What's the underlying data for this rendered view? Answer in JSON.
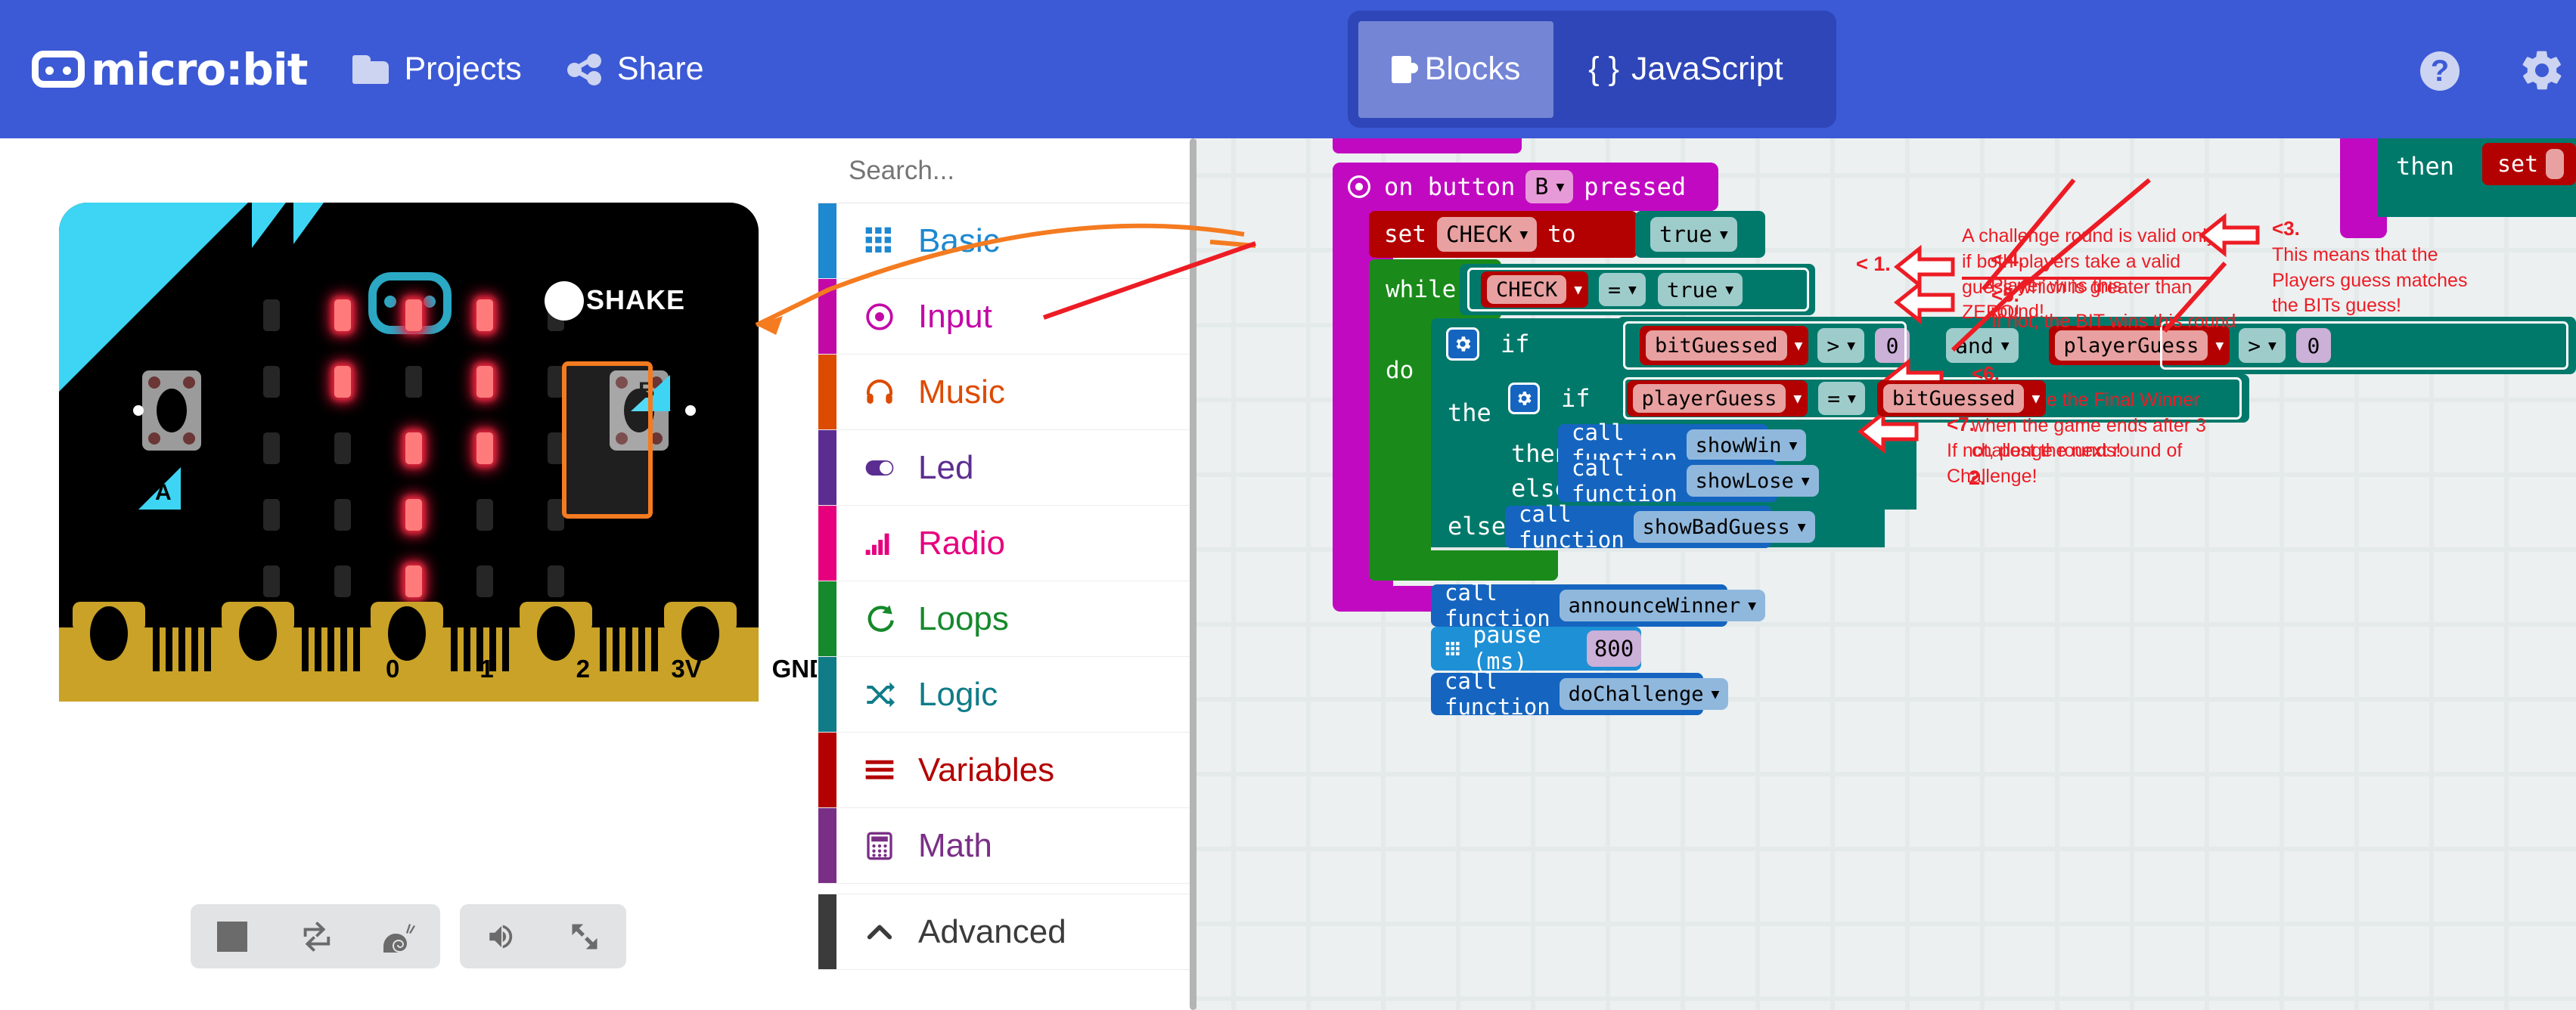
{
  "header": {
    "brand": "micro:bit",
    "projects_label": "Projects",
    "share_label": "Share",
    "tabs": [
      {
        "id": "blocks",
        "label": "Blocks",
        "active": true
      },
      {
        "id": "javascript",
        "label": "JavaScript",
        "active": false
      }
    ],
    "help_glyph": "?",
    "bg_color": "#3c5ad5",
    "tab_group_color": "#2e46b8",
    "active_tab_color": "#7485d6"
  },
  "simulator": {
    "shake_label": "SHAKE",
    "button_a_label": "A",
    "button_b_label": "B",
    "pin_labels": [
      "0",
      "1",
      "2",
      "3V",
      "GND"
    ],
    "led_on_color": "#ff7b7b",
    "led_off_color": "#262626",
    "highlight_color": "#f47b20",
    "led_matrix": [
      [
        0,
        1,
        1,
        1,
        0
      ],
      [
        0,
        1,
        0,
        1,
        0
      ],
      [
        0,
        0,
        1,
        1,
        0
      ],
      [
        0,
        0,
        1,
        0,
        0
      ],
      [
        0,
        0,
        1,
        0,
        0
      ]
    ],
    "controls": [
      {
        "name": "stop-button",
        "icon": "stop-icon"
      },
      {
        "name": "restart-button",
        "icon": "restart-icon"
      },
      {
        "name": "slow-motion-button",
        "icon": "snail-icon"
      },
      {
        "name": "mute-button",
        "icon": "speaker-icon"
      },
      {
        "name": "fullscreen-button",
        "icon": "expand-icon"
      }
    ]
  },
  "toolbox": {
    "search_placeholder": "Search...",
    "categories": [
      {
        "label": "Basic",
        "color": "#1e88d0",
        "icon": "grid-icon"
      },
      {
        "label": "Input",
        "color": "#c209a6",
        "icon": "target-icon"
      },
      {
        "label": "Music",
        "color": "#dd4b00",
        "icon": "headphones-icon"
      },
      {
        "label": "Led",
        "color": "#5c2d91",
        "icon": "toggle-icon"
      },
      {
        "label": "Radio",
        "color": "#e6007e",
        "icon": "signal-icon"
      },
      {
        "label": "Loops",
        "color": "#15892b",
        "icon": "loop-icon"
      },
      {
        "label": "Logic",
        "color": "#0f7c88",
        "icon": "shuffle-icon"
      },
      {
        "label": "Variables",
        "color": "#b30000",
        "icon": "lines-icon"
      },
      {
        "label": "Math",
        "color": "#7a2f86",
        "icon": "calculator-icon"
      },
      {
        "label": "Advanced",
        "color": "#3b3b3b",
        "icon": "chevron-up-icon"
      }
    ]
  },
  "workspace": {
    "event_block": {
      "text_before": "on button",
      "dropdown": "B",
      "text_after": "pressed"
    },
    "set_check": {
      "keyword": "set",
      "variable": "CHECK",
      "to": "to",
      "value": "true"
    },
    "while_block": {
      "keyword": "while",
      "left": "CHECK",
      "operator": "=",
      "right": "true",
      "do": "do"
    },
    "outer_if": {
      "keyword": "if",
      "cond_left_var": "bitGuessed",
      "cond_left_op": ">",
      "cond_left_val": "0",
      "joiner": "and",
      "cond_right_var": "playerGuess",
      "cond_right_op": ">",
      "cond_right_val": "0",
      "then": "then",
      "else": "else"
    },
    "inner_if": {
      "keyword": "if",
      "left": "playerGuess",
      "operator": "=",
      "right": "bitGuessed",
      "then": "then",
      "else": "else"
    },
    "calls": {
      "call_label": "call function",
      "show_win": "showWin",
      "show_lose": "showLose",
      "show_bad_guess": "showBadGuess",
      "announce_winner": "announceWinner",
      "do_challenge": "doChallenge"
    },
    "pause_block": {
      "label": "pause (ms)",
      "value": "800"
    },
    "top_right_fragment": {
      "then": "then",
      "set": "set"
    }
  },
  "annotations": [
    {
      "id": "n1",
      "marker": "< 1.",
      "text": ""
    },
    {
      "id": "n2",
      "marker": "2.",
      "text": ""
    },
    {
      "id": "nvalid",
      "marker": "",
      "text": "A challenge round is valid only if both players take a valid guess which is greater than ZERO!"
    },
    {
      "id": "n3",
      "marker": "<3.",
      "text": "This means that the Players guess matches the BITs guess!"
    },
    {
      "id": "n4",
      "marker": "< 4.",
      "text": "Player wins this round!"
    },
    {
      "id": "n5",
      "marker": "<5.",
      "text": "If not, the BIT wins this round"
    },
    {
      "id": "n6",
      "marker": "<6.",
      "text": "Announce the Final Winner when the game ends after 3 challenge rounds!"
    },
    {
      "id": "n7",
      "marker": "<7.",
      "text": "If not, post the next round of Challenge!"
    }
  ]
}
